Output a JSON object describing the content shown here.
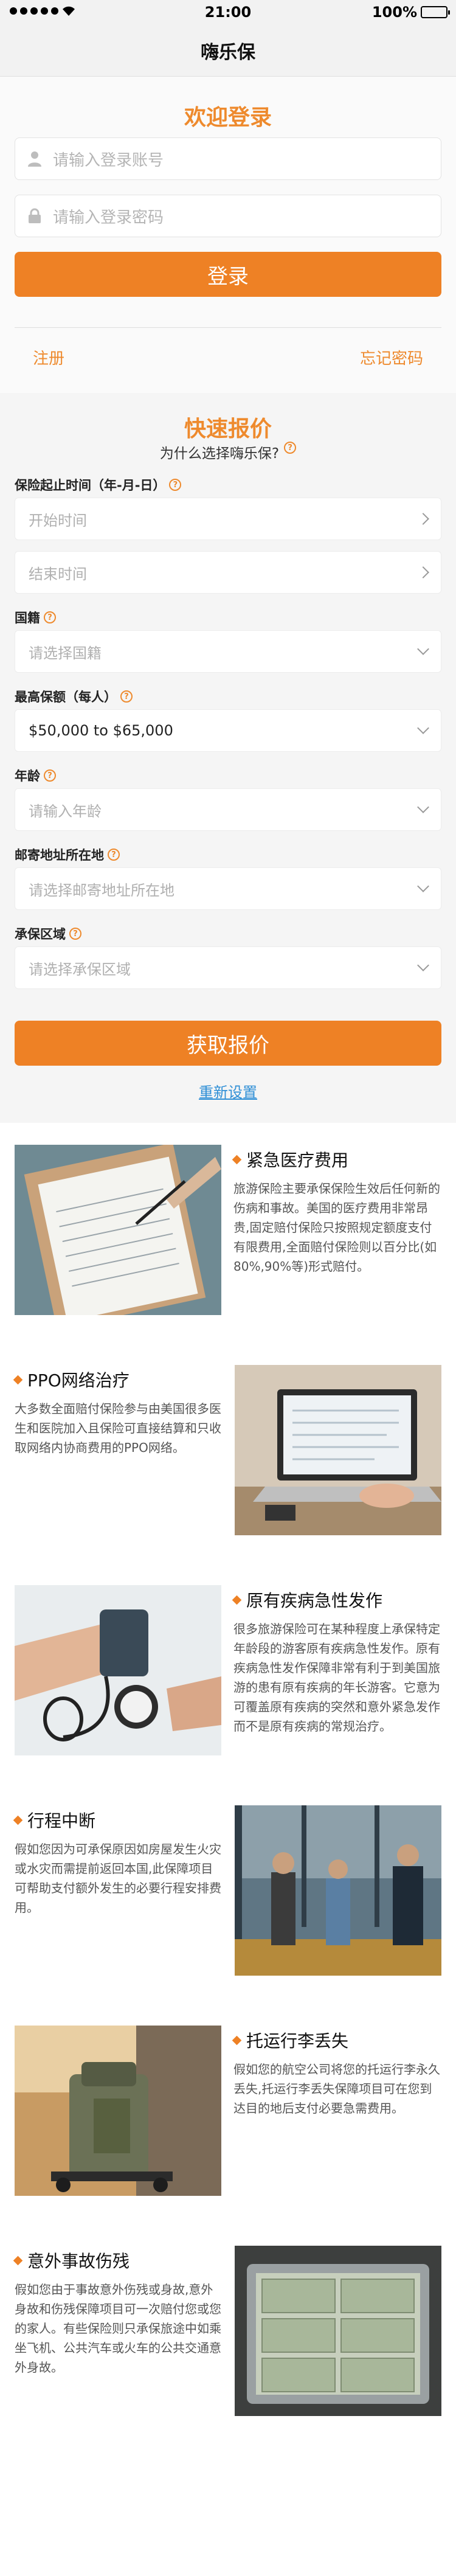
{
  "status_bar": {
    "time": "21:00",
    "battery": "100%"
  },
  "nav": {
    "title": "嗨乐保"
  },
  "login": {
    "title": "欢迎登录",
    "account_placeholder": "请输入登录账号",
    "password_placeholder": "请输入登录密码",
    "login_button": "登录",
    "register_link": "注册",
    "forgot_link": "忘记密码"
  },
  "quote": {
    "title": "快速报价",
    "subtitle": "为什么选择嗨乐保?",
    "period_label": "保险起止时间（年-月-日）",
    "start_placeholder": "开始时间",
    "end_placeholder": "结束时间",
    "nationality_label": "国籍",
    "nationality_placeholder": "请选择国籍",
    "max_coverage_label": "最高保额（每人）",
    "max_coverage_value": "$50,000 to $65,000",
    "age_label": "年龄",
    "age_placeholder": "请输入年龄",
    "mailing_label": "邮寄地址所在地",
    "mailing_placeholder": "请选择邮寄地址所在地",
    "area_label": "承保区域",
    "area_placeholder": "请选择承保区域",
    "get_quote_button": "获取报价",
    "reset_link": "重新设置"
  },
  "features": [
    {
      "title": "紧急医疗费用",
      "desc": "旅游保险主要承保保险生效后任何新的伤病和事故。美国的医疗费用非常昂贵,固定赔付保险只按照规定额度支付有限费用,全面赔付保险则以百分比(如80%,90%等)形式赔付。"
    },
    {
      "title": "PPO网络治疗",
      "desc": "大多数全面赔付保险参与由美国很多医生和医院加入且保险可直接结算和只收取网络内协商费用的PPO网络。"
    },
    {
      "title": "原有疾病急性发作",
      "desc": "很多旅游保险可在某种程度上承保特定年龄段的游客原有疾病急性发作。原有疾病急性发作保障非常有利于到美国旅游的患有原有疾病的年长游客。它意为可覆盖原有疾病的突然和意外紧急发作而不是原有疾病的常规治疗。"
    },
    {
      "title": "行程中断",
      "desc": "假如您因为可承保原因如房屋发生火灾或水灾而需提前返回本国,此保障项目可帮助支付额外发生的必要行程安排费用。"
    },
    {
      "title": "托运行李丢失",
      "desc": "假如您的航空公司将您的托运行李永久丢失,托运行李丢失保障项目可在您到达目的地后支付必要急需费用。"
    },
    {
      "title": "意外事故伤残",
      "desc": "假如您由于事故意外伤残或身故,意外身故和伤残保障项目可一次赔付您或您的家人。有些保险则只承保旅途中如乘坐飞机、公共汽车或火车的公共交通意外身故。"
    }
  ],
  "colors": {
    "accent": "#ee8125",
    "accent_text": "#ee8a2d",
    "link": "#2f8fd6"
  },
  "icons": {
    "user": "user-icon",
    "lock": "lock-icon",
    "help": "help-icon"
  }
}
